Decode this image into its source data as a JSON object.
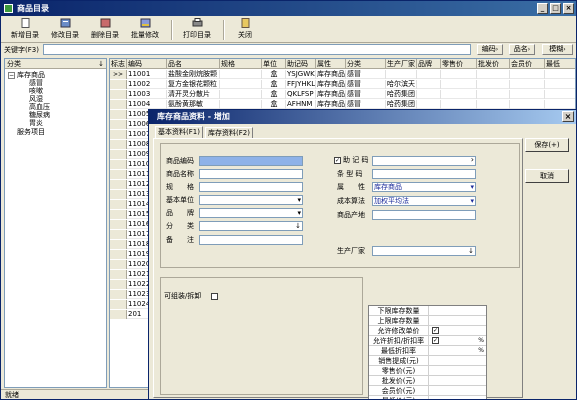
{
  "window": {
    "title": "商品目录"
  },
  "toolbar": {
    "buttons": [
      {
        "label": "新增目录",
        "icon": "new-doc-icon"
      },
      {
        "label": "修改目录",
        "icon": "edit-icon"
      },
      {
        "label": "删除目录",
        "icon": "delete-icon"
      },
      {
        "label": "批量修改",
        "icon": "batch-edit-icon"
      },
      {
        "label": "打印目录",
        "icon": "printer-icon"
      },
      {
        "label": "关闭",
        "icon": "close-door-icon"
      }
    ]
  },
  "keyword": {
    "label": "关键字(F3)",
    "value": "",
    "btn1": "编码",
    "btn2": "品名",
    "btn3": "模糊"
  },
  "tree": {
    "header": "分类",
    "root": "库存商品",
    "children": [
      "感冒",
      "咳嗽",
      "风湿",
      "高血压",
      "糖尿病",
      "胃炎"
    ],
    "service": "服务项目"
  },
  "grid": {
    "columns": [
      "标志",
      "编码",
      "品名",
      "规格",
      "单位",
      "助记码",
      "属性",
      "分类",
      "生产厂家",
      "品牌",
      "零售价",
      "批发价",
      "会员价",
      "最低"
    ],
    "rows": [
      {
        "mark": ">>",
        "code": "11001",
        "name": "盐酸金刚烷胺颗",
        "unit": "盒",
        "mnemonic": "YSJGWKL",
        "attr": "库存商品",
        "cat": "感冒",
        "maker": ""
      },
      {
        "mark": "",
        "code": "11002",
        "name": "复方金银花颗粒",
        "unit": "盒",
        "mnemonic": "FFJYHKL",
        "attr": "库存商品",
        "cat": "感冒",
        "maker": "哈尔滨天"
      },
      {
        "mark": "",
        "code": "11003",
        "name": "清开灵分散片",
        "unit": "盒",
        "mnemonic": "QKLFSP",
        "attr": "库存商品",
        "cat": "感冒",
        "maker": "哈药集团"
      },
      {
        "mark": "",
        "code": "11004",
        "name": "氨酚黄那敏",
        "unit": "盒",
        "mnemonic": "AFHNM",
        "attr": "库存商品",
        "cat": "感冒",
        "maker": "哈药集团"
      },
      {
        "mark": "",
        "code": "11005",
        "name": "",
        "unit": "",
        "mnemonic": "",
        "attr": "",
        "cat": "",
        "maker": ""
      },
      {
        "mark": "",
        "code": "11006",
        "name": "",
        "unit": "",
        "mnemonic": "",
        "attr": "",
        "cat": "",
        "maker": ""
      },
      {
        "mark": "",
        "code": "11007",
        "name": "",
        "unit": "",
        "mnemonic": "",
        "attr": "",
        "cat": "",
        "maker": ""
      },
      {
        "mark": "",
        "code": "11008",
        "name": "",
        "unit": "",
        "mnemonic": "",
        "attr": "",
        "cat": "",
        "maker": ""
      },
      {
        "mark": "",
        "code": "11009",
        "name": "",
        "unit": "",
        "mnemonic": "",
        "attr": "",
        "cat": "",
        "maker": ""
      },
      {
        "mark": "",
        "code": "11010",
        "name": "",
        "unit": "",
        "mnemonic": "",
        "attr": "",
        "cat": "",
        "maker": ""
      },
      {
        "mark": "",
        "code": "11011",
        "name": "",
        "unit": "",
        "mnemonic": "",
        "attr": "",
        "cat": "",
        "maker": ""
      },
      {
        "mark": "",
        "code": "11012",
        "name": "",
        "unit": "",
        "mnemonic": "",
        "attr": "",
        "cat": "",
        "maker": ""
      },
      {
        "mark": "",
        "code": "11013",
        "name": "",
        "unit": "",
        "mnemonic": "",
        "attr": "",
        "cat": "",
        "maker": ""
      },
      {
        "mark": "",
        "code": "11014",
        "name": "",
        "unit": "",
        "mnemonic": "",
        "attr": "",
        "cat": "",
        "maker": ""
      },
      {
        "mark": "",
        "code": "11015",
        "name": "",
        "unit": "",
        "mnemonic": "",
        "attr": "",
        "cat": "",
        "maker": ""
      },
      {
        "mark": "",
        "code": "11016",
        "name": "",
        "unit": "",
        "mnemonic": "",
        "attr": "",
        "cat": "",
        "maker": ""
      },
      {
        "mark": "",
        "code": "11017",
        "name": "",
        "unit": "",
        "mnemonic": "",
        "attr": "",
        "cat": "",
        "maker": ""
      },
      {
        "mark": "",
        "code": "11018",
        "name": "",
        "unit": "",
        "mnemonic": "",
        "attr": "",
        "cat": "",
        "maker": ""
      },
      {
        "mark": "",
        "code": "11019",
        "name": "",
        "unit": "",
        "mnemonic": "",
        "attr": "",
        "cat": "",
        "maker": ""
      },
      {
        "mark": "",
        "code": "11020",
        "name": "",
        "unit": "",
        "mnemonic": "",
        "attr": "",
        "cat": "",
        "maker": ""
      },
      {
        "mark": "",
        "code": "11021",
        "name": "",
        "unit": "",
        "mnemonic": "",
        "attr": "",
        "cat": "",
        "maker": ""
      },
      {
        "mark": "",
        "code": "11022",
        "name": "",
        "unit": "",
        "mnemonic": "",
        "attr": "",
        "cat": "",
        "maker": ""
      },
      {
        "mark": "",
        "code": "11023",
        "name": "",
        "unit": "",
        "mnemonic": "",
        "attr": "",
        "cat": "",
        "maker": ""
      },
      {
        "mark": "",
        "code": "11024",
        "name": "",
        "unit": "",
        "mnemonic": "",
        "attr": "",
        "cat": "",
        "maker": ""
      },
      {
        "mark": "",
        "code": "201",
        "name": "",
        "unit": "",
        "mnemonic": "",
        "attr": "",
        "cat": "",
        "maker": ""
      }
    ]
  },
  "status": {
    "text": "就绪"
  },
  "dialog": {
    "title": "库存商品资料 - 增加",
    "tab1": "基本资料(F1)",
    "tab2": "库存资料(F2)",
    "fields": {
      "code_label": "商品编码",
      "code_value": "",
      "name_label": "商品名称",
      "name_value": "",
      "spec_label": "规　　格",
      "spec_value": "",
      "unit_label": "基本单位",
      "unit_value": "",
      "brand_label": "品　　牌",
      "brand_value": "",
      "category_label": "分　　类",
      "category_value": "",
      "note_label": "备　　注",
      "note_value": "",
      "mnemonic_label": "助 记 码",
      "mnemonic_value": "",
      "mnemonic_checked": "✓",
      "barcode_label": "条 型 码",
      "barcode_value": "",
      "attr_label": "属　　性",
      "attr_value": "库存商品",
      "cost_label": "成本算法",
      "cost_value": "加权平均法",
      "origin_label": "商品产地",
      "origin_value": "",
      "maker_label": "生产厂家",
      "maker_value": ""
    },
    "split_label": "可组装/拆卸",
    "price_table": [
      {
        "label": "下限库存数量",
        "type": "text",
        "value": ""
      },
      {
        "label": "上限库存数量",
        "type": "text",
        "value": ""
      },
      {
        "label": "允许修改单价",
        "type": "check",
        "value": "✓"
      },
      {
        "label": "允许折扣/折扣率",
        "type": "checkpct",
        "value": "✓",
        "unit": "%"
      },
      {
        "label": "最低折扣率",
        "type": "pct",
        "value": "",
        "unit": "%"
      },
      {
        "label": "销售提成(元)",
        "type": "text",
        "value": ""
      },
      {
        "label": "零售价(元)",
        "type": "text",
        "value": ""
      },
      {
        "label": "批发价(元)",
        "type": "text",
        "value": ""
      },
      {
        "label": "会员价(元)",
        "type": "text",
        "value": ""
      },
      {
        "label": "最低价(元)",
        "type": "text",
        "value": ""
      }
    ],
    "save_label": "保存(+)",
    "cancel_label": "取消"
  }
}
